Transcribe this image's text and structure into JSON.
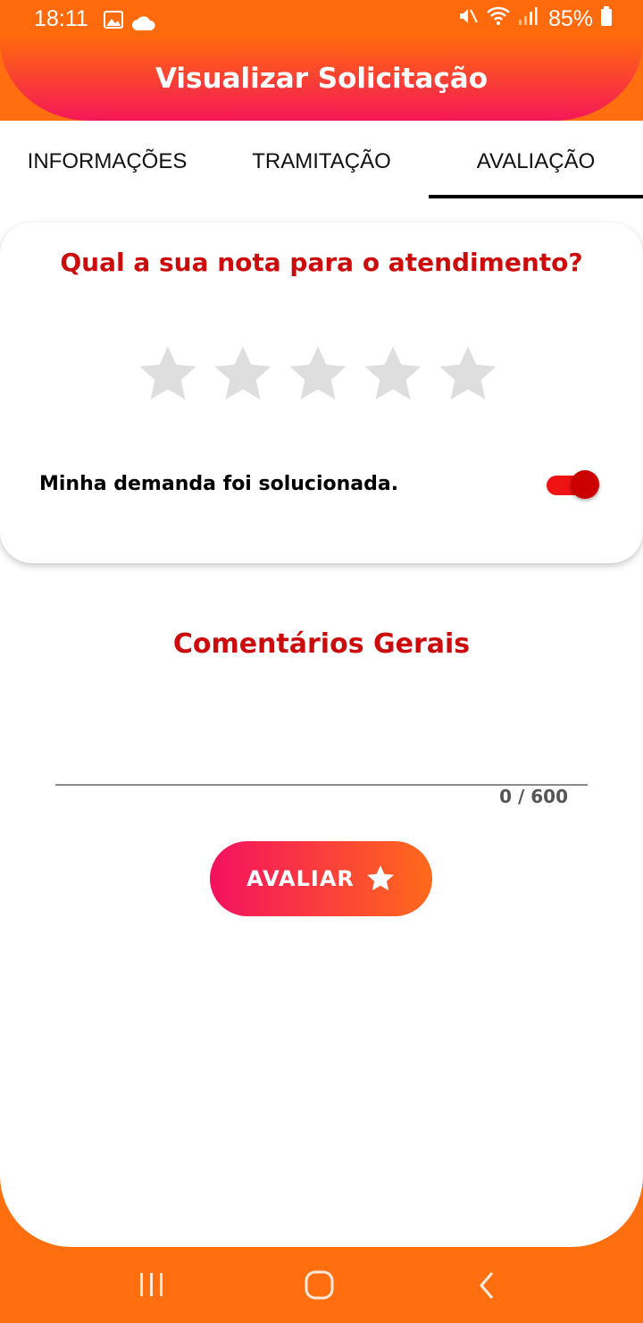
{
  "status_bar": {
    "time": "18:11",
    "battery": "85%"
  },
  "header": {
    "title": "Visualizar Solicitação"
  },
  "tabs": [
    {
      "label": "INFORMAÇÕES",
      "selected": false
    },
    {
      "label": "TRAMITAÇÃO",
      "selected": false
    },
    {
      "label": "AVALIAÇÃO",
      "selected": true
    }
  ],
  "rating": {
    "question": "Qual a sua nota para o atendimento?",
    "stars_total": 5,
    "stars_selected": 0,
    "solved_label": "Minha demanda foi solucionada.",
    "solved_toggle": true
  },
  "comments": {
    "title": "Comentários Gerais",
    "value": "",
    "counter": "0 / 600"
  },
  "actions": {
    "evaluate_label": "AVALIAR"
  },
  "colors": {
    "accent_red": "#cc0c0c",
    "orange": "#ff6f10",
    "pink": "#f51858",
    "star_inactive": "#dedede"
  }
}
